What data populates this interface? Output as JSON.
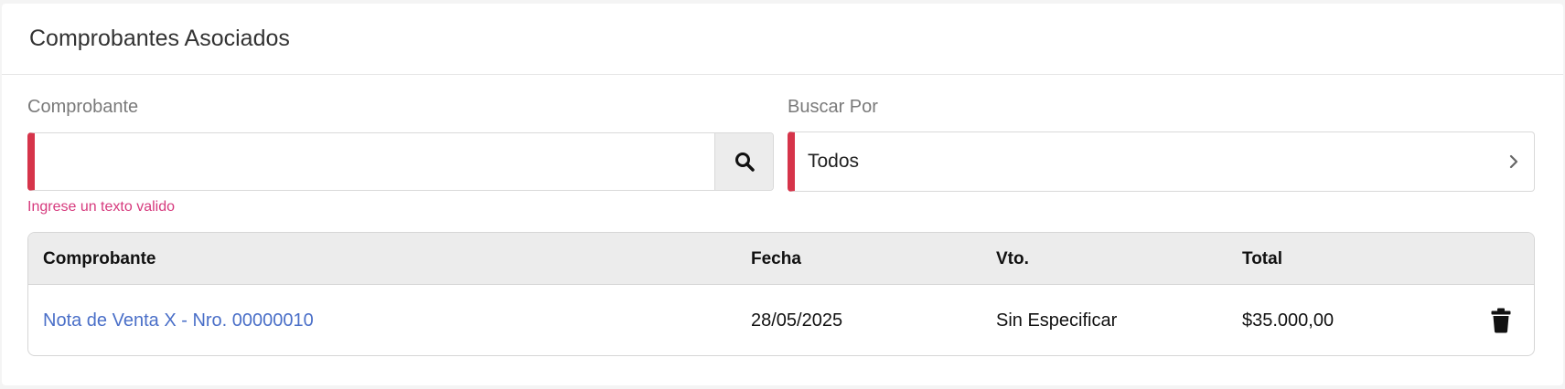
{
  "card": {
    "title": "Comprobantes Asociados"
  },
  "form": {
    "comprobante_label": "Comprobante",
    "comprobante_value": "",
    "comprobante_error": "Ingrese un texto valido",
    "search_icon": "search-icon",
    "buscar_por_label": "Buscar Por",
    "buscar_por_value": "Todos",
    "chevron_icon": "chevron-right-icon",
    "invalid_color": "#d6344a"
  },
  "table": {
    "headers": {
      "comprobante": "Comprobante",
      "fecha": "Fecha",
      "vto": "Vto.",
      "total": "Total"
    },
    "rows": [
      {
        "comprobante": "Nota de Venta X - Nro. 00000010",
        "fecha": "28/05/2025",
        "vto": "Sin Especificar",
        "total": "$35.000,00",
        "action_icon": "trash-icon"
      }
    ]
  }
}
